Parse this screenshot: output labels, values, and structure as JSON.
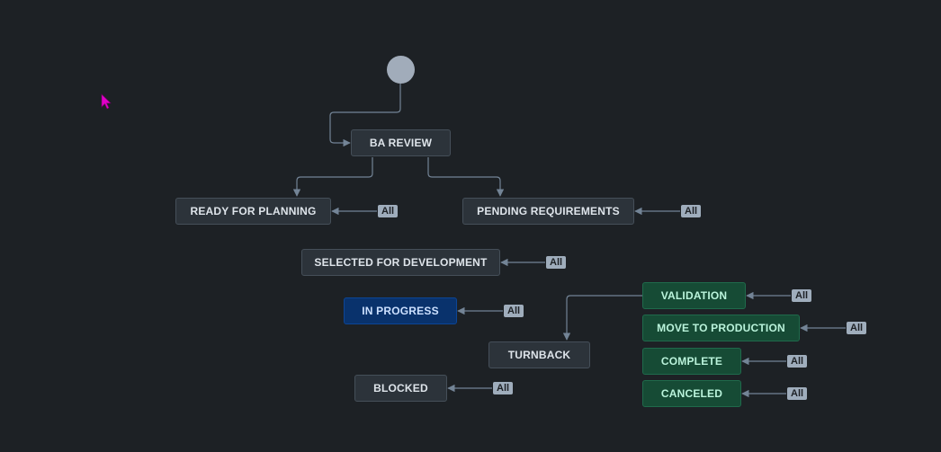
{
  "workflow": {
    "colors": {
      "todo": "#2c333a",
      "in_progress": "#09326c",
      "done": "#164b35",
      "edge": "#738496",
      "badge": "#9fadbc"
    },
    "start": {
      "icon": "start-circle-icon"
    },
    "statuses": {
      "ba_review": "BA REVIEW",
      "ready_for_planning": "READY FOR PLANNING",
      "pending_requirements": "PENDING REQUIREMENTS",
      "selected_for_development": "SELECTED FOR DEVELOPMENT",
      "in_progress": "IN PROGRESS",
      "turnback": "TURNBACK",
      "blocked": "BLOCKED",
      "validation": "VALIDATION",
      "move_to_production": "MOVE TO PRODUCTION",
      "complete": "COMPLETE",
      "canceled": "CANCELED"
    },
    "all_label": "All"
  },
  "cursor": {
    "icon": "mouse-pointer-icon",
    "color": "#e000c8"
  }
}
